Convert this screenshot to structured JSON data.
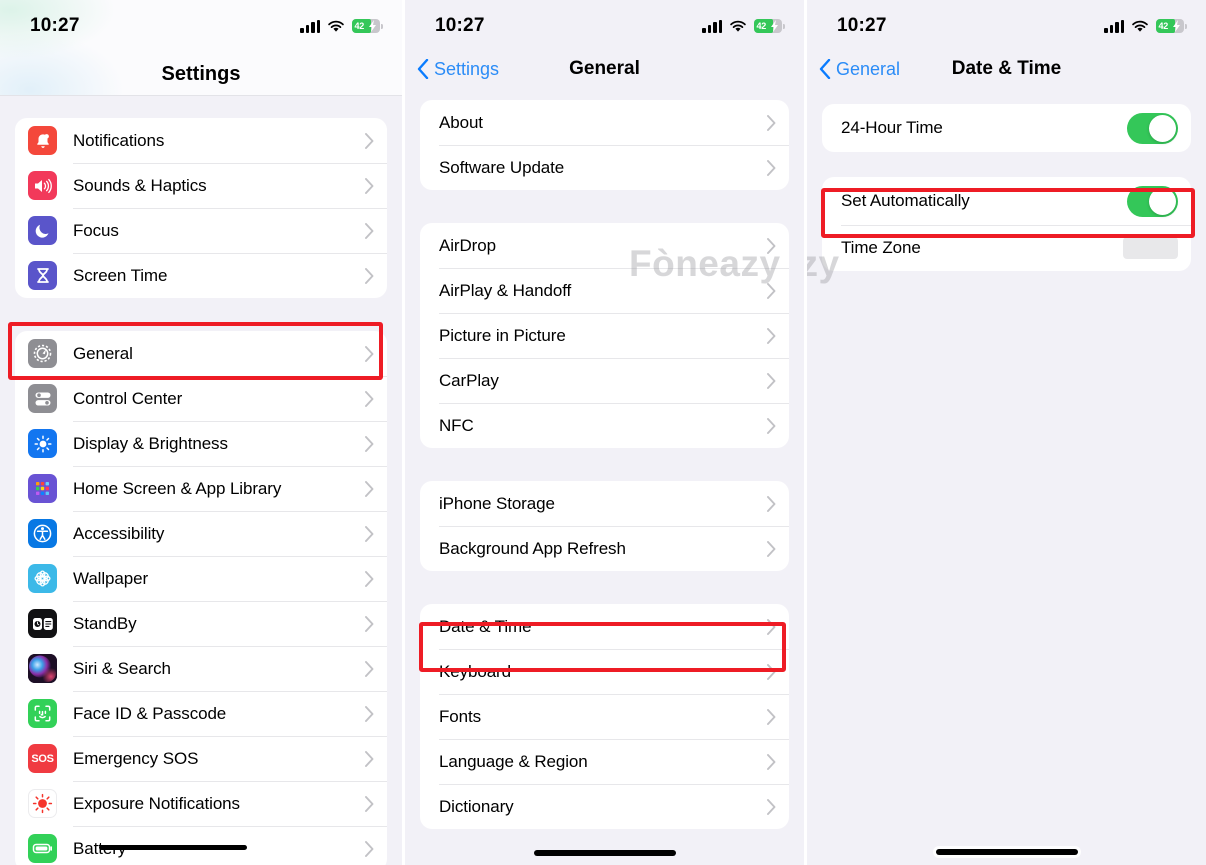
{
  "statusbar": {
    "time": "10:27",
    "battery_pct": "42",
    "icons": [
      "cellular-signal-icon",
      "wifi-icon",
      "battery-charging-icon"
    ]
  },
  "watermark": {
    "text": "Fòneazy"
  },
  "colors": {
    "highlight": "#ee1c25",
    "toggle_on": "#34c759",
    "link_blue": "#2b8cf7",
    "page_bg": "#f2f1f7"
  },
  "screen1": {
    "title": "Settings",
    "groups": [
      {
        "rows": [
          {
            "label": "Notifications",
            "icon": "notifications-icon",
            "icon_bg": "#f4483b",
            "accessory": "chevron"
          },
          {
            "label": "Sounds & Haptics",
            "icon": "sounds-haptics-icon",
            "icon_bg": "#f2395a",
            "accessory": "chevron"
          },
          {
            "label": "Focus",
            "icon": "focus-moon-icon",
            "icon_bg": "#5a55ca",
            "accessory": "chevron"
          },
          {
            "label": "Screen Time",
            "icon": "screen-time-hourglass-icon",
            "icon_bg": "#5a55ca",
            "accessory": "chevron"
          }
        ]
      },
      {
        "rows": [
          {
            "label": "General",
            "icon": "general-gear-icon",
            "icon_bg": "#8e8e93",
            "accessory": "chevron",
            "highlighted": true
          },
          {
            "label": "Control Center",
            "icon": "control-center-icon",
            "icon_bg": "#8e8e93",
            "accessory": "chevron"
          },
          {
            "label": "Display & Brightness",
            "icon": "display-brightness-icon",
            "icon_bg": "#1376f0",
            "accessory": "chevron"
          },
          {
            "label": "Home Screen & App Library",
            "icon": "home-screen-grid-icon",
            "icon_bg": "#6953d4",
            "accessory": "chevron"
          },
          {
            "label": "Accessibility",
            "icon": "accessibility-icon",
            "icon_bg": "#0878e4",
            "accessory": "chevron"
          },
          {
            "label": "Wallpaper",
            "icon": "wallpaper-flower-icon",
            "icon_bg": "#3cb9e8",
            "accessory": "chevron"
          },
          {
            "label": "StandBy",
            "icon": "standby-icon",
            "icon_bg": "#1c1c1e",
            "accessory": "chevron"
          },
          {
            "label": "Siri & Search",
            "icon": "siri-icon",
            "icon_bg": "#2c1b3c",
            "accessory": "chevron"
          },
          {
            "label": "Face ID & Passcode",
            "icon": "face-id-icon",
            "icon_bg": "#32d158",
            "accessory": "chevron"
          },
          {
            "label": "Emergency SOS",
            "icon": "emergency-sos-icon",
            "icon_bg": "#f03b41",
            "accessory": "chevron"
          },
          {
            "label": "Exposure Notifications",
            "icon": "exposure-notifications-icon",
            "icon_bg": "#ffffff",
            "accessory": "chevron"
          },
          {
            "label": "Battery",
            "icon": "battery-icon",
            "icon_bg": "#32d158",
            "accessory": "chevron"
          }
        ]
      }
    ]
  },
  "screen2": {
    "back_label": "Settings",
    "title": "General",
    "groups": [
      {
        "rows": [
          {
            "label": "About",
            "accessory": "chevron"
          },
          {
            "label": "Software Update",
            "accessory": "chevron"
          }
        ]
      },
      {
        "rows": [
          {
            "label": "AirDrop",
            "accessory": "chevron"
          },
          {
            "label": "AirPlay & Handoff",
            "accessory": "chevron"
          },
          {
            "label": "Picture in Picture",
            "accessory": "chevron"
          },
          {
            "label": "CarPlay",
            "accessory": "chevron"
          },
          {
            "label": "NFC",
            "accessory": "chevron"
          }
        ]
      },
      {
        "rows": [
          {
            "label": "iPhone Storage",
            "accessory": "chevron"
          },
          {
            "label": "Background App Refresh",
            "accessory": "chevron"
          }
        ]
      },
      {
        "rows": [
          {
            "label": "Date & Time",
            "accessory": "chevron",
            "highlighted": true
          },
          {
            "label": "Keyboard",
            "accessory": "chevron"
          },
          {
            "label": "Fonts",
            "accessory": "chevron"
          },
          {
            "label": "Language & Region",
            "accessory": "chevron"
          },
          {
            "label": "Dictionary",
            "accessory": "chevron"
          }
        ]
      }
    ]
  },
  "screen3": {
    "back_label": "General",
    "title": "Date & Time",
    "groups": [
      {
        "rows": [
          {
            "label": "24-Hour Time",
            "accessory": "toggle",
            "toggle_on": true
          }
        ]
      },
      {
        "rows": [
          {
            "label": "Set Automatically",
            "accessory": "toggle",
            "toggle_on": true,
            "highlighted": true
          },
          {
            "label": "Time Zone",
            "accessory": "placeholder"
          }
        ]
      }
    ]
  }
}
